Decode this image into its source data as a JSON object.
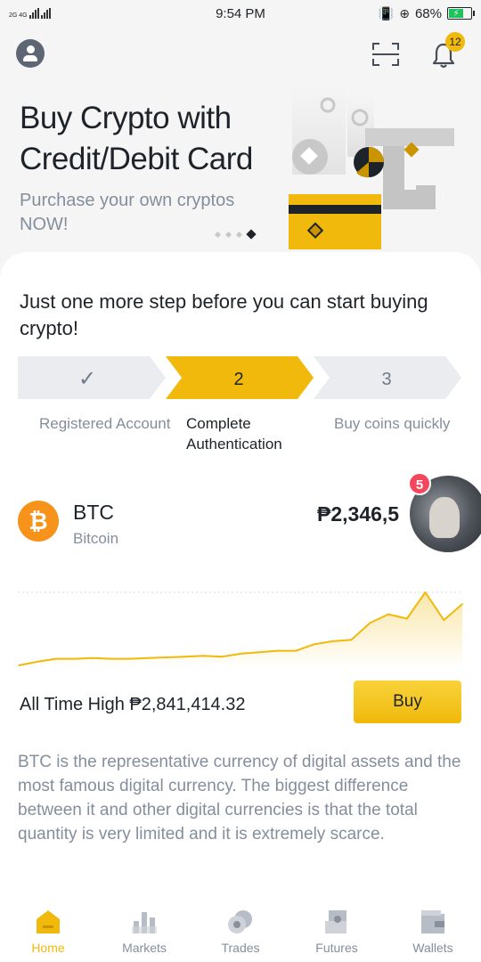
{
  "status_bar": {
    "network": "2G 4G",
    "time": "9:54 PM",
    "battery": "68%"
  },
  "header": {
    "notification_count": "12"
  },
  "banner": {
    "title": "Buy Crypto with Credit/Debit Card",
    "subtitle": "Purchase your own cryptos NOW!",
    "slide_count": 4,
    "active_slide": 4
  },
  "steps": {
    "title": "Just one more step before you can start buying crypto!",
    "items": [
      {
        "marker": "✓",
        "label": "Registered Account",
        "state": "done"
      },
      {
        "marker": "2",
        "label": "Complete Authentication",
        "state": "current"
      },
      {
        "marker": "3",
        "label": "Buy coins quickly",
        "state": "pending"
      }
    ]
  },
  "coin": {
    "symbol": "BTC",
    "name": "Bitcoin",
    "icon": "bitcoin-icon",
    "price": "₱2,346,5",
    "all_time_high": "All Time High ₱2,841,414.32",
    "buy_label": "Buy",
    "description": "BTC is the representative currency of digital assets and the most famous digital currency. The biggest difference between it and other digital currencies is that the total quantity is very limited and it is extremely scarce."
  },
  "chat_bubble": {
    "unread": "5"
  },
  "chart_data": {
    "type": "area",
    "x": [
      0,
      1,
      2,
      3,
      4,
      5,
      6,
      7,
      8,
      9,
      10,
      11,
      12,
      13,
      14,
      15,
      16,
      17,
      18,
      19,
      20,
      21,
      22,
      23,
      24
    ],
    "values": [
      0.0,
      0.05,
      0.09,
      0.09,
      0.1,
      0.09,
      0.09,
      0.1,
      0.11,
      0.12,
      0.13,
      0.12,
      0.16,
      0.18,
      0.2,
      0.2,
      0.29,
      0.33,
      0.35,
      0.58,
      0.7,
      0.64,
      1.0,
      0.62,
      0.84
    ],
    "title": "",
    "xlabel": "",
    "ylabel": "",
    "color": "#f0b90b",
    "grid": false,
    "reference_line": "dashed at maximum"
  },
  "tabs": [
    {
      "label": "Home",
      "icon": "home-icon",
      "active": true
    },
    {
      "label": "Markets",
      "icon": "markets-icon",
      "active": false
    },
    {
      "label": "Trades",
      "icon": "trades-icon",
      "active": false
    },
    {
      "label": "Futures",
      "icon": "futures-icon",
      "active": false
    },
    {
      "label": "Wallets",
      "icon": "wallets-icon",
      "active": false
    }
  ],
  "colors": {
    "brand": "#f0b90b",
    "text_primary": "#1e2329",
    "text_secondary": "#848e9c",
    "step_pending": "#eaecef",
    "bitcoin": "#f7931a",
    "alert": "#f6465d"
  }
}
